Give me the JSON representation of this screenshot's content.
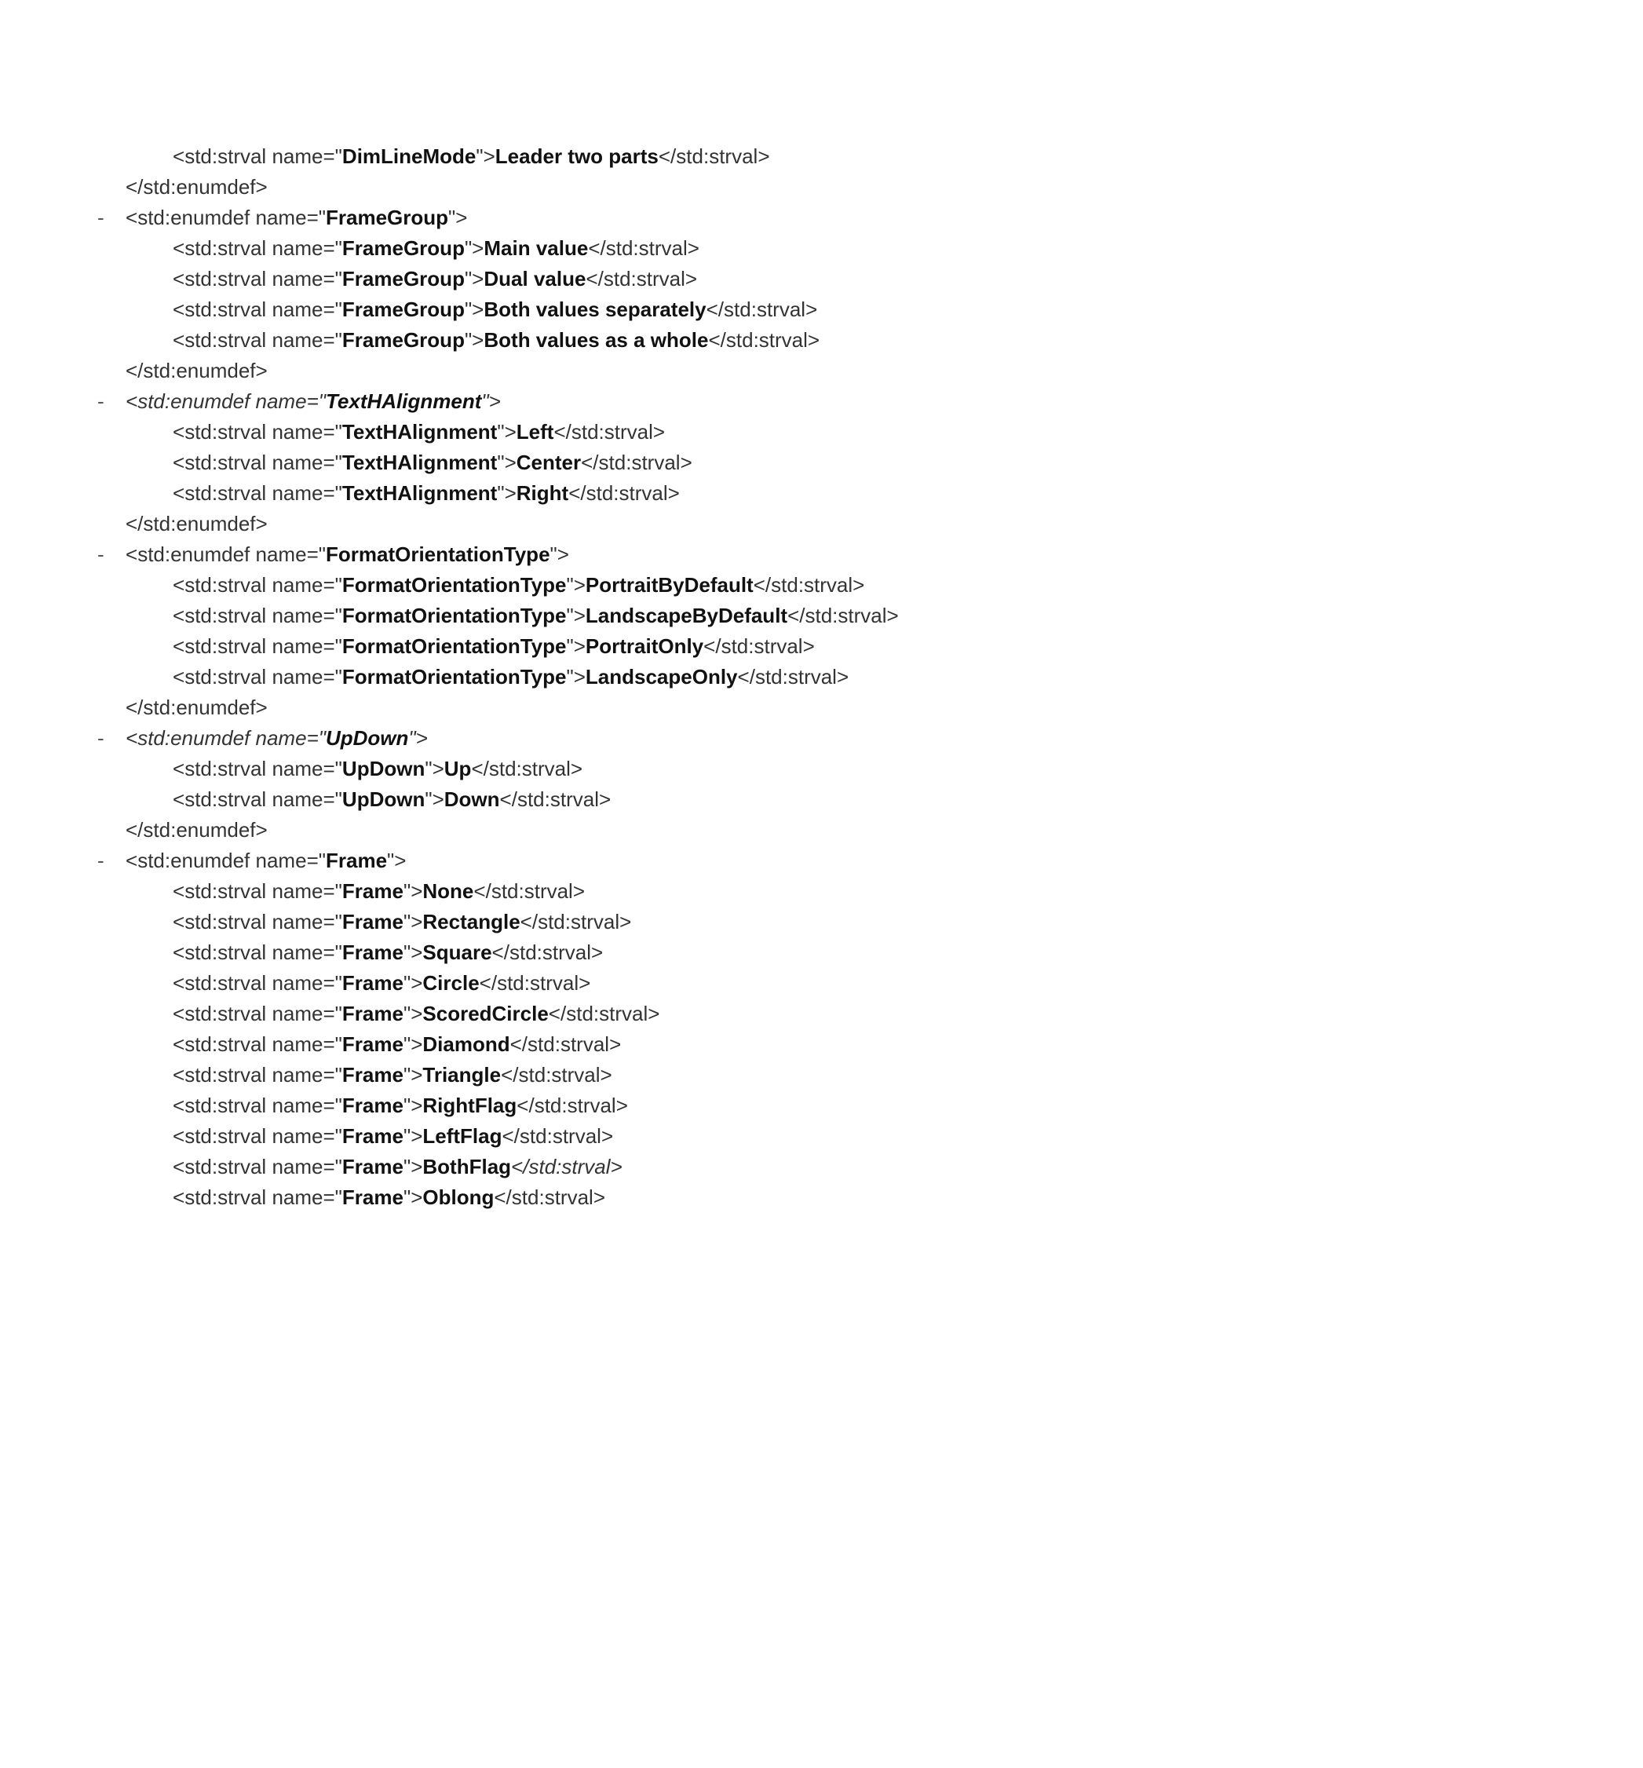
{
  "items": [
    {
      "type": "strval",
      "indent": 2,
      "enum": "DimLineMode",
      "value": "Leader two parts"
    },
    {
      "type": "close-enum",
      "indent": 1
    },
    {
      "type": "open-enum",
      "indent": 1,
      "toggle": "-",
      "name": "FrameGroup"
    },
    {
      "type": "strval",
      "indent": 2,
      "enum": "FrameGroup",
      "value": "Main value"
    },
    {
      "type": "strval",
      "indent": 2,
      "enum": "FrameGroup",
      "value": "Dual value"
    },
    {
      "type": "strval",
      "indent": 2,
      "enum": "FrameGroup",
      "value": "Both values separately"
    },
    {
      "type": "strval",
      "indent": 2,
      "enum": "FrameGroup",
      "value": "Both values as a whole"
    },
    {
      "type": "close-enum",
      "indent": 1
    },
    {
      "type": "open-enum",
      "indent": 1,
      "toggle": "-",
      "name": "TextHAlignment",
      "italic": true
    },
    {
      "type": "strval",
      "indent": 2,
      "enum": "TextHAlignment",
      "value": "Left"
    },
    {
      "type": "strval",
      "indent": 2,
      "enum": "TextHAlignment",
      "value": "Center"
    },
    {
      "type": "strval",
      "indent": 2,
      "enum": "TextHAlignment",
      "value": "Right"
    },
    {
      "type": "close-enum",
      "indent": 1
    },
    {
      "type": "open-enum",
      "indent": 1,
      "toggle": "-",
      "name": "FormatOrientationType"
    },
    {
      "type": "strval",
      "indent": 2,
      "enum": "FormatOrientationType",
      "value": "PortraitByDefault"
    },
    {
      "type": "strval",
      "indent": 2,
      "enum": "FormatOrientationType",
      "value": "LandscapeByDefault"
    },
    {
      "type": "strval",
      "indent": 2,
      "enum": "FormatOrientationType",
      "value": "PortraitOnly"
    },
    {
      "type": "strval",
      "indent": 2,
      "enum": "FormatOrientationType",
      "value": "LandscapeOnly"
    },
    {
      "type": "close-enum",
      "indent": 1
    },
    {
      "type": "open-enum",
      "indent": 1,
      "toggle": "-",
      "name": "UpDown",
      "italic": true
    },
    {
      "type": "strval",
      "indent": 2,
      "enum": "UpDown",
      "value": "Up"
    },
    {
      "type": "strval",
      "indent": 2,
      "enum": "UpDown",
      "value": "Down"
    },
    {
      "type": "close-enum",
      "indent": 1
    },
    {
      "type": "open-enum",
      "indent": 1,
      "toggle": "-",
      "name": "Frame"
    },
    {
      "type": "strval",
      "indent": 2,
      "enum": "Frame",
      "value": "None"
    },
    {
      "type": "strval",
      "indent": 2,
      "enum": "Frame",
      "value": "Rectangle"
    },
    {
      "type": "strval",
      "indent": 2,
      "enum": "Frame",
      "value": "Square"
    },
    {
      "type": "strval",
      "indent": 2,
      "enum": "Frame",
      "value": "Circle"
    },
    {
      "type": "strval",
      "indent": 2,
      "enum": "Frame",
      "value": "ScoredCircle"
    },
    {
      "type": "strval",
      "indent": 2,
      "enum": "Frame",
      "value": "Diamond"
    },
    {
      "type": "strval",
      "indent": 2,
      "enum": "Frame",
      "value": "Triangle"
    },
    {
      "type": "strval",
      "indent": 2,
      "enum": "Frame",
      "value": "RightFlag"
    },
    {
      "type": "strval",
      "indent": 2,
      "enum": "Frame",
      "value": "LeftFlag"
    },
    {
      "type": "strval",
      "indent": 2,
      "enum": "Frame",
      "value": "BothFlag",
      "italicClose": true
    },
    {
      "type": "strval",
      "indent": 2,
      "enum": "Frame",
      "value": "Oblong"
    }
  ]
}
